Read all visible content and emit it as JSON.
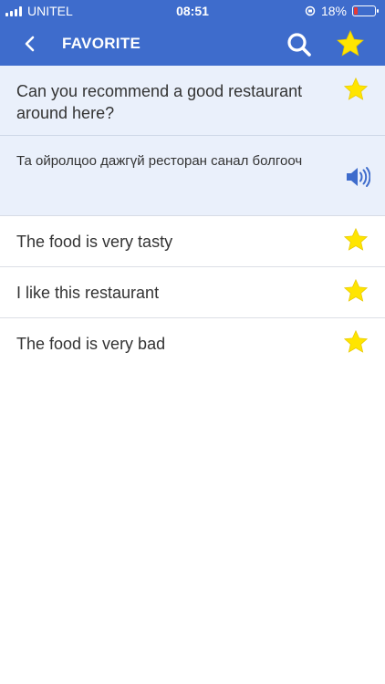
{
  "status_bar": {
    "carrier": "UNITEL",
    "time": "08:51",
    "battery": "18%",
    "battery_level": 0.18,
    "icons": [
      "signal-icon",
      "rotation-lock-icon",
      "battery-icon"
    ]
  },
  "header": {
    "title": "FAVORITE",
    "icons": [
      "back-chevron-icon",
      "search-icon",
      "star-icon"
    ]
  },
  "colors": {
    "header_bg": "#3e6ccc",
    "expanded_bg": "#eaf0fb",
    "star": "#ffe500",
    "speaker": "#3e6ccc"
  },
  "favorites": [
    {
      "phrase": "Can you recommend a good restaurant around here?",
      "translation": "Та ойролцоо дажгүй ресторан санал болгооч",
      "expanded": true
    },
    {
      "phrase": "The food is very tasty"
    },
    {
      "phrase": "I like this restaurant"
    },
    {
      "phrase": "The food is very bad"
    }
  ]
}
